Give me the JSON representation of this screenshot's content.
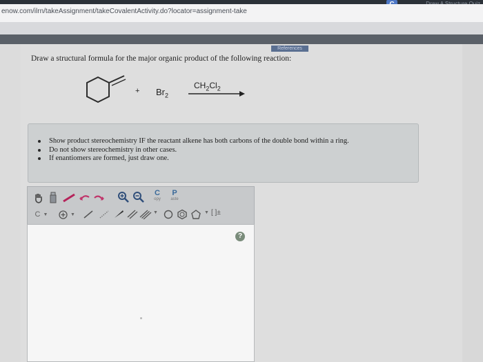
{
  "browser": {
    "badge": "C",
    "top_right": "Draw A Structure Quiz",
    "url": "enow.com/ilrn/takeAssignment/takeCovalentActivity.do?locator=assignment-take"
  },
  "question": {
    "references_label": "References",
    "prompt": "Draw a structural formula for the major organic product of the following reaction:",
    "reagent_br": "Br",
    "reagent_sub": "2",
    "plus": "+",
    "solvent_pre": "CH",
    "solvent_s1": "2",
    "solvent_mid": "Cl",
    "solvent_s2": "2"
  },
  "instructions": [
    "Show product stereochemistry IF the reactant alkene has both carbons of the double bond within a ring.",
    "Do not show stereochemistry in other cases.",
    "If enantiomers are formed, just draw one."
  ],
  "toolbar": {
    "copy_label": "C",
    "copy_sub": "opy",
    "paste_label": "P",
    "paste_sub": "aste",
    "element_label": "C",
    "bracket_label": "[ ]±",
    "help_label": "?"
  },
  "colors": {
    "accent": "#4c76c4",
    "references_bg": "#5a6f91",
    "help_icon": "#7a8c7b"
  }
}
